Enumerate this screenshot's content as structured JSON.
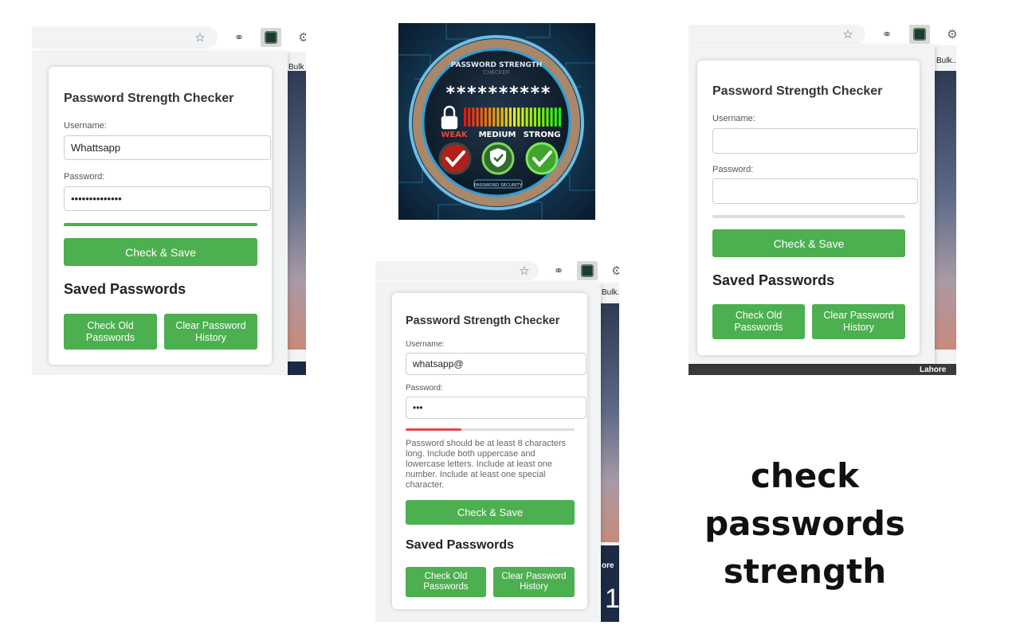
{
  "shared": {
    "popup_title": "Password Strength Checker",
    "username_label": "Username:",
    "password_label": "Password:",
    "check_save": "Check & Save",
    "saved_passwords": "Saved Passwords",
    "check_old": "Check Old Passwords",
    "clear_history": "Clear Password History",
    "bookmark_label": "Bulk...",
    "bookmark_label_short": "Bulk",
    "star_icon": "star-icon",
    "link_icon": "link-icon",
    "puzzle_icon": "puzzle-icon"
  },
  "left_panel": {
    "username": "Whattsapp",
    "password": "••••••••••••••",
    "strength": 1.0,
    "strength_color": "#4caf50"
  },
  "middle_panel": {
    "username": "whatsapp@",
    "password": "•••",
    "strength": 0.33,
    "strength_color": "#e04a4a",
    "message": "Password should be at least 8 characters long. Include both uppercase and lowercase letters. Include at least one number. Include at least one special character.",
    "bg_more": "ore",
    "bg_number": "1"
  },
  "right_panel": {
    "username": "",
    "password": "",
    "strength": 0,
    "bg_lahore": "Lahore"
  },
  "art": {
    "title": "PASSWORD STRENGTH",
    "subtitle": "CHECKER",
    "masked": "**********",
    "weak": "WEAK",
    "medium": "MEDIUM",
    "strong": "STRONG",
    "footer": "PASSWORD SECURITY"
  },
  "heading": {
    "line1": "check",
    "line2": "passwords strength"
  },
  "colors": {
    "accent": "#4caf50",
    "weak": "#e04a4a"
  }
}
